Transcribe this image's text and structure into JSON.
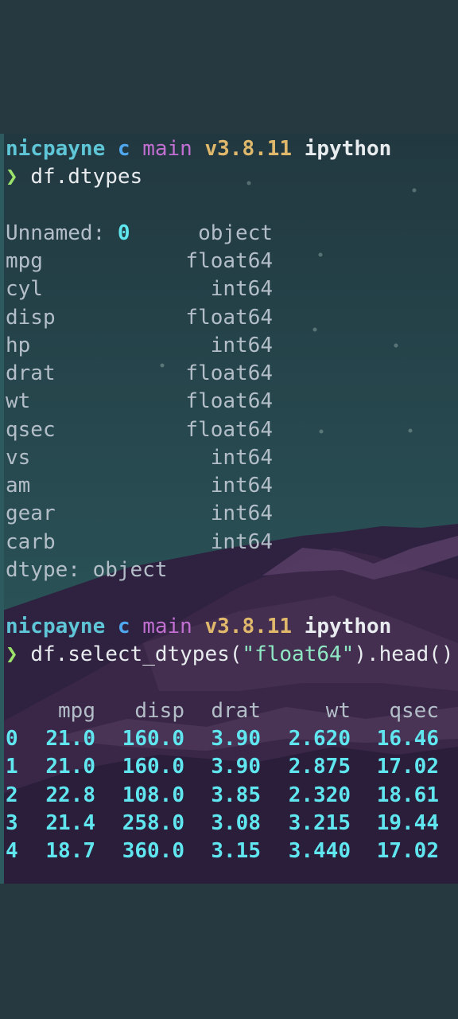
{
  "prompt1": {
    "user": "nicpayne",
    "branch_icon": "c",
    "branch": "main",
    "version": "v3.8.11",
    "env": "ipython",
    "arrow": "❯",
    "command": "df.dtypes"
  },
  "dtypes": [
    {
      "col": "Unnamed: ",
      "col_num": "0",
      "type": "object"
    },
    {
      "col": "mpg",
      "type": "float64"
    },
    {
      "col": "cyl",
      "type": "int64"
    },
    {
      "col": "disp",
      "type": "float64"
    },
    {
      "col": "hp",
      "type": "int64"
    },
    {
      "col": "drat",
      "type": "float64"
    },
    {
      "col": "wt",
      "type": "float64"
    },
    {
      "col": "qsec",
      "type": "float64"
    },
    {
      "col": "vs",
      "type": "int64"
    },
    {
      "col": "am",
      "type": "int64"
    },
    {
      "col": "gear",
      "type": "int64"
    },
    {
      "col": "carb",
      "type": "int64"
    }
  ],
  "dtype_footer": "dtype: object",
  "prompt2": {
    "user": "nicpayne",
    "branch_icon": "c",
    "branch": "main",
    "version": "v3.8.11",
    "env": "ipython",
    "arrow": "❯",
    "command_pre": "df.select_dtypes(",
    "command_str": "\"float64\"",
    "command_post": ").head()"
  },
  "table": {
    "columns": [
      "mpg",
      "disp",
      "drat",
      "wt",
      "qsec"
    ],
    "rows": [
      {
        "index": "0",
        "values": [
          "21.0",
          "160.0",
          "3.90",
          "2.620",
          "16.46"
        ]
      },
      {
        "index": "1",
        "values": [
          "21.0",
          "160.0",
          "3.90",
          "2.875",
          "17.02"
        ]
      },
      {
        "index": "2",
        "values": [
          "22.8",
          "108.0",
          "3.85",
          "2.320",
          "18.61"
        ]
      },
      {
        "index": "3",
        "values": [
          "21.4",
          "258.0",
          "3.08",
          "3.215",
          "19.44"
        ]
      },
      {
        "index": "4",
        "values": [
          "18.7",
          "360.0",
          "3.15",
          "3.440",
          "17.02"
        ]
      }
    ]
  },
  "colors": {
    "page_background": "#263840",
    "user": "#5ec6d6",
    "branch": "#c26fd2",
    "version": "#e0b86b",
    "prompt_arrow": "#9be36a",
    "numbers": "#5fe6ef"
  }
}
